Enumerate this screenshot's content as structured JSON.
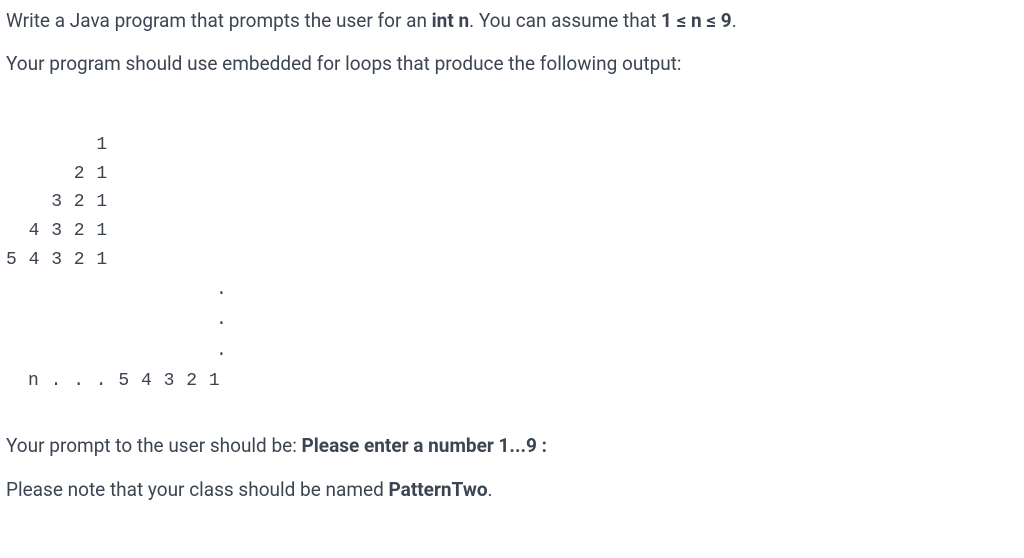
{
  "paragraphs": {
    "p1_pre": "Write a Java program that prompts the user for an ",
    "p1_bold1": "int n",
    "p1_mid": ". You can assume that ",
    "p1_bold2": "1 ≤ n ≤ 9",
    "p1_post": ".",
    "p2": "Your program should use embedded for loops that produce the following output:",
    "p3_pre": "Your prompt to the user should be: ",
    "p3_bold": "Please enter a number 1...9 :",
    "p4_pre": "Please note that your class should be named ",
    "p4_bold": "PatternTwo",
    "p4_post": "."
  },
  "pattern": {
    "line1": "        1",
    "line2": "      2 1",
    "line3": "    3 2 1",
    "line4": "  4 3 2 1",
    "line5": "5 4 3 2 1",
    "dot": ".",
    "final": "n . . . 5 4 3 2 1"
  }
}
